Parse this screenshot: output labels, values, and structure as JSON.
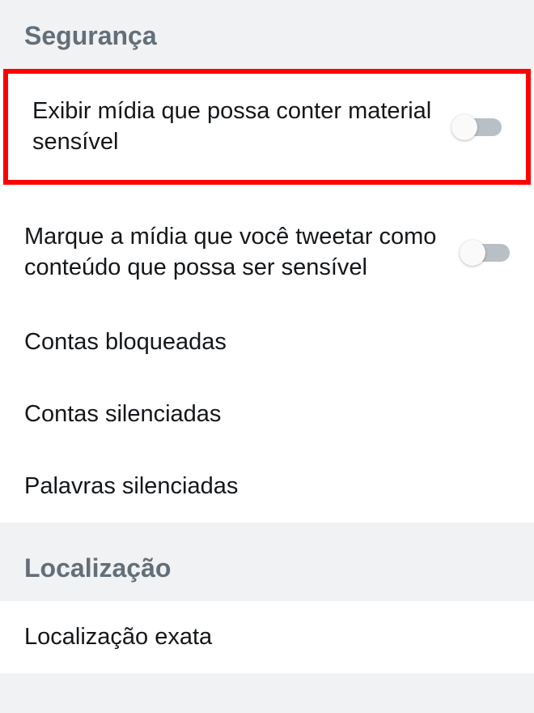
{
  "security": {
    "header": "Segurança",
    "display_sensitive_media_label": "Exibir mídia que possa conter material sensível",
    "mark_media_sensitive_label": "Marque a mídia que você tweetar como conteúdo que possa ser sensível",
    "blocked_accounts_label": "Contas bloqueadas",
    "muted_accounts_label": "Contas silenciadas",
    "muted_words_label": "Palavras silenciadas"
  },
  "localization": {
    "header": "Localização",
    "precise_location_label": "Localização exata"
  }
}
